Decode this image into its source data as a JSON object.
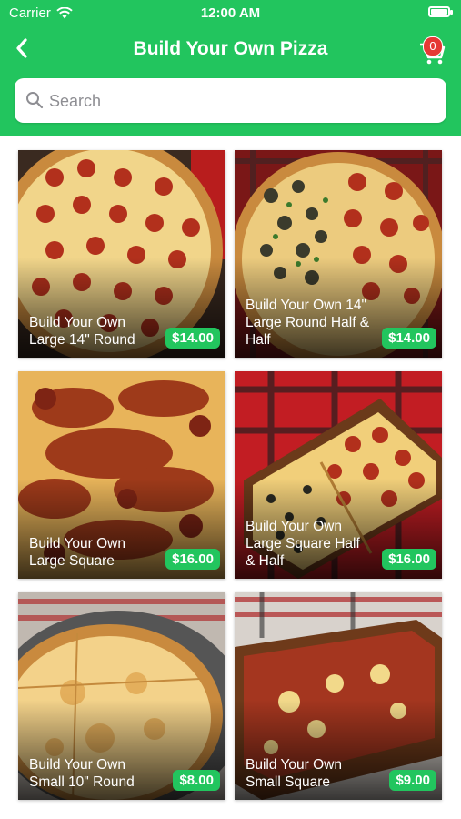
{
  "status_bar": {
    "carrier": "Carrier",
    "time": "12:00 AM"
  },
  "header": {
    "title": "Build Your Own Pizza",
    "cart_count": "0"
  },
  "search": {
    "placeholder": "Search"
  },
  "colors": {
    "accent": "#22c55e",
    "badge": "#e53935"
  },
  "products": [
    {
      "name": "Build Your Own Large 14\" Round",
      "price": "$14.00"
    },
    {
      "name": "Build Your Own 14\" Large Round Half & Half",
      "price": "$14.00"
    },
    {
      "name": "Build Your Own Large Square",
      "price": "$16.00"
    },
    {
      "name": "Build Your Own Large Square Half & Half",
      "price": "$16.00"
    },
    {
      "name": "Build Your Own Small 10\" Round",
      "price": "$8.00"
    },
    {
      "name": "Build Your Own Small Square",
      "price": "$9.00"
    }
  ]
}
